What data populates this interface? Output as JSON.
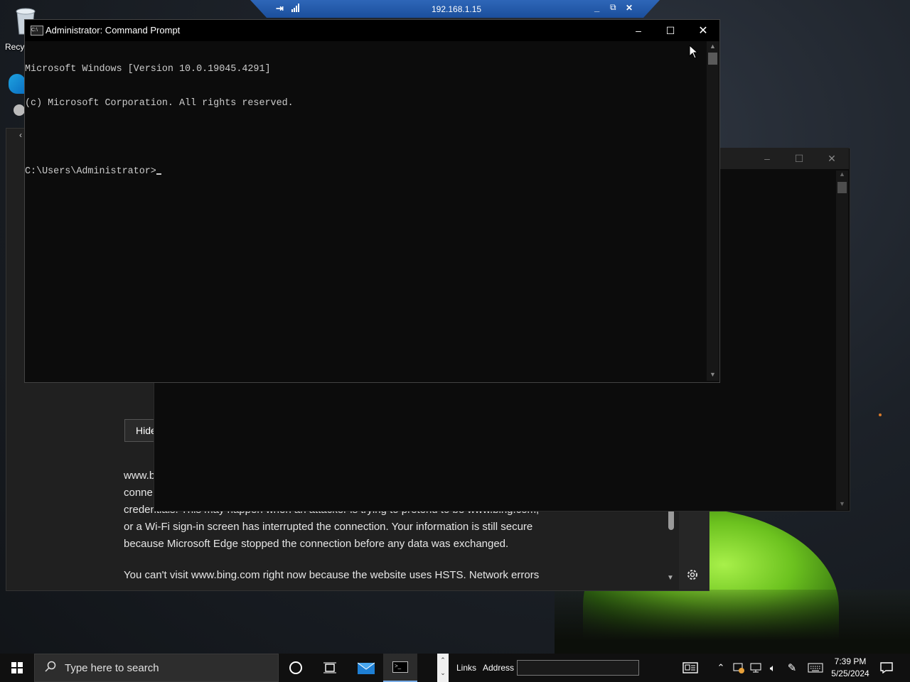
{
  "rdp_bar": {
    "host": "192.168.1.15"
  },
  "desktop": {
    "recycle_label": "Recy"
  },
  "edge_window": {
    "hide_label": "Hide",
    "para1_lines": [
      "www.b",
      "conne",
      "credentials. This may happen when an attacker is trying to pretend to be www.bing.com,",
      "or a Wi-Fi sign-in screen has interrupted the connection. Your information is still secure",
      "because Microsoft Edge stopped the connection before any data was exchanged."
    ],
    "para2": "You can't visit www.bing.com right now because the website uses HSTS. Network errors"
  },
  "console": {
    "title": "Administrator: Command Prompt",
    "lines": [
      "Microsoft Windows [Version 10.0.19045.4291]",
      "(c) Microsoft Corporation. All rights reserved.",
      "",
      "C:\\Users\\Administrator>"
    ]
  },
  "taskbar": {
    "search_placeholder": "Type here to search",
    "links_label": "Links",
    "address_label": "Address",
    "time": "7:39 PM",
    "date": "5/25/2024"
  }
}
